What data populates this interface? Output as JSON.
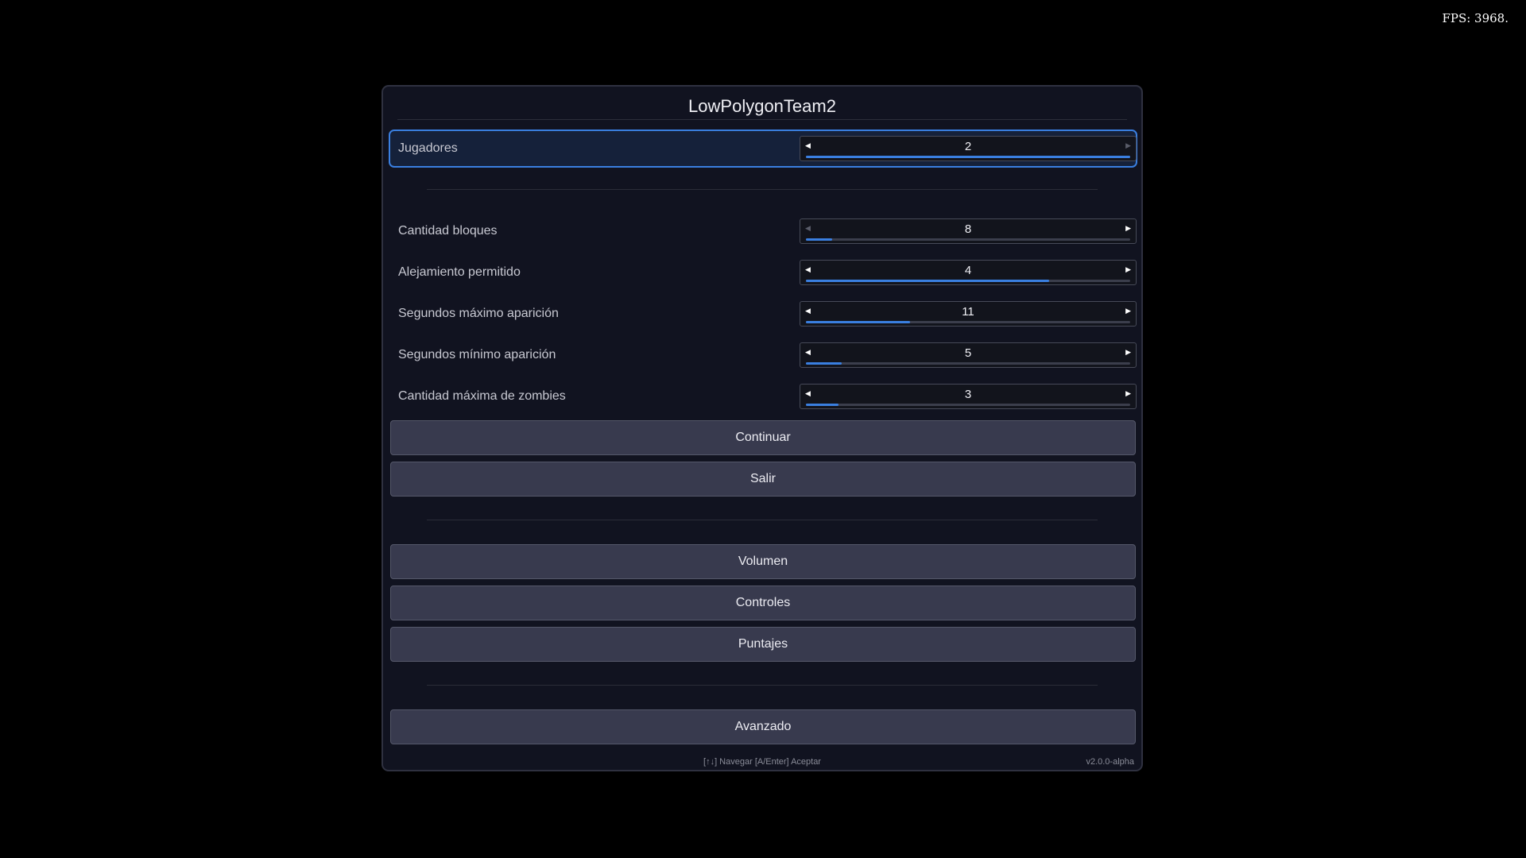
{
  "fps_counter": "FPS: 3968.",
  "title": "LowPolygonTeam2",
  "settings": [
    {
      "label": "Jugadores",
      "value": "2",
      "level": 1.0,
      "left_enabled": true,
      "right_enabled": false,
      "selected": true
    },
    {
      "label": "Cantidad bloques",
      "value": "8",
      "level": 0.08,
      "left_enabled": false,
      "right_enabled": true,
      "selected": false
    },
    {
      "label": "Alejamiento permitido",
      "value": "4",
      "level": 0.75,
      "left_enabled": true,
      "right_enabled": true,
      "selected": false
    },
    {
      "label": "Segundos máximo aparición",
      "value": "11",
      "level": 0.32,
      "left_enabled": true,
      "right_enabled": true,
      "selected": false
    },
    {
      "label": "Segundos mínimo aparición",
      "value": "5",
      "level": 0.11,
      "left_enabled": true,
      "right_enabled": true,
      "selected": false
    },
    {
      "label": "Cantidad máxima de zombies",
      "value": "3",
      "level": 0.1,
      "left_enabled": true,
      "right_enabled": true,
      "selected": false
    }
  ],
  "actions": {
    "continue_label": "Continuar",
    "exit_label": "Salir"
  },
  "options": {
    "volume_label": "Volumen",
    "controls_label": "Controles",
    "scores_label": "Puntajes"
  },
  "advanced_label": "Avanzado",
  "footer": {
    "hint": "[↑↓] Navegar  [A/Enter] Aceptar",
    "version": "v2.0.0-alpha"
  },
  "colors": {
    "accent": "#3a7fe0",
    "panel": "#111320",
    "button": "#383a4e"
  },
  "icons": {
    "decrease": "triangle-left-icon",
    "increase": "triangle-right-icon"
  }
}
